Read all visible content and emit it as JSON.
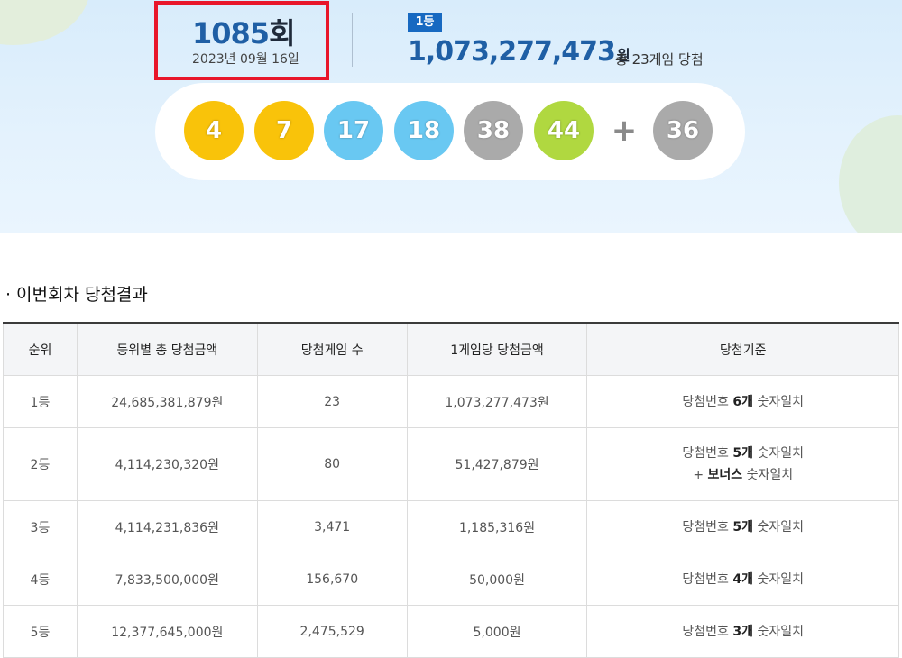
{
  "draw": {
    "number": "1085",
    "suffix": "회",
    "date": "2023년 09월 16일"
  },
  "first_prize": {
    "badge": "1등",
    "amount": "1,073,277,473",
    "unit": "원",
    "winners_text": "총 23게임 당첨"
  },
  "balls": [
    {
      "number": "4",
      "color": "#f9c30a"
    },
    {
      "number": "7",
      "color": "#f9c30a"
    },
    {
      "number": "17",
      "color": "#69c8f2"
    },
    {
      "number": "18",
      "color": "#69c8f2"
    },
    {
      "number": "38",
      "color": "#aaaaaa"
    },
    {
      "number": "44",
      "color": "#b0d840"
    }
  ],
  "plus": "+",
  "bonus": {
    "number": "36",
    "color": "#aaaaaa"
  },
  "section_title": "이번회차 당첨결과",
  "section_bullet": "·",
  "table": {
    "headers": [
      "순위",
      "등위별 총 당첨금액",
      "당첨게임 수",
      "1게임당 당첨금액",
      "당첨기준"
    ],
    "rows": [
      {
        "rank": "1등",
        "total": "24,685,381,879원",
        "games": "23",
        "per_game": "1,073,277,473원",
        "criteria": {
          "pre": "당첨번호 ",
          "bold": "6개",
          "post": " 숫자일치"
        }
      },
      {
        "rank": "2등",
        "total": "4,114,230,320원",
        "games": "80",
        "per_game": "51,427,879원",
        "criteria": {
          "pre": "당첨번호 ",
          "bold": "5개",
          "post": " 숫자일치",
          "line2_pre": "+ ",
          "line2_bold": "보너스",
          "line2_post": " 숫자일치"
        }
      },
      {
        "rank": "3등",
        "total": "4,114,231,836원",
        "games": "3,471",
        "per_game": "1,185,316원",
        "criteria": {
          "pre": "당첨번호 ",
          "bold": "5개",
          "post": " 숫자일치"
        }
      },
      {
        "rank": "4등",
        "total": "7,833,500,000원",
        "games": "156,670",
        "per_game": "50,000원",
        "criteria": {
          "pre": "당첨번호 ",
          "bold": "4개",
          "post": " 숫자일치"
        }
      },
      {
        "rank": "5등",
        "total": "12,377,645,000원",
        "games": "2,475,529",
        "per_game": "5,000원",
        "criteria": {
          "pre": "당첨번호 ",
          "bold": "3개",
          "post": " 숫자일치"
        }
      }
    ]
  }
}
